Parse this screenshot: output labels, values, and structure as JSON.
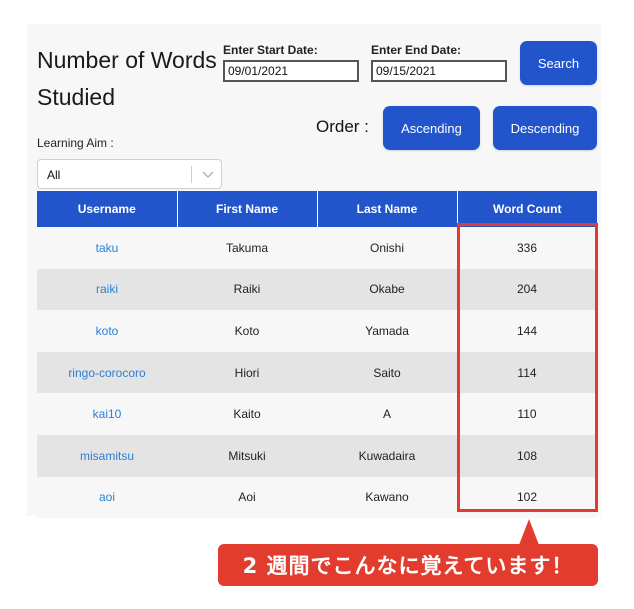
{
  "page": {
    "title": "Number of Words Studied"
  },
  "filters": {
    "start_date_label": "Enter Start Date:",
    "start_date_value": "09/01/2021",
    "end_date_label": "Enter End Date:",
    "end_date_value": "09/15/2021",
    "search_label": "Search",
    "order_label": "Order :",
    "ascending_label": "Ascending",
    "descending_label": "Descending",
    "learning_aim_label": "Learning Aim :",
    "learning_aim_value": "All"
  },
  "table": {
    "headers": [
      "Username",
      "First Name",
      "Last Name",
      "Word Count"
    ],
    "rows": [
      [
        "taku",
        "Takuma",
        "Onishi",
        "336"
      ],
      [
        "raiki",
        "Raiki",
        "Okabe",
        "204"
      ],
      [
        "koto",
        "Koto",
        "Yamada",
        "144"
      ],
      [
        "ringo-corocoro",
        "Hiori",
        "Saito",
        "114"
      ],
      [
        "kai10",
        "Kaito",
        "A",
        "110"
      ],
      [
        "misamitsu",
        "Mitsuki",
        "Kuwadaira",
        "108"
      ],
      [
        "aoi",
        "Aoi",
        "Kawano",
        "102"
      ]
    ]
  },
  "callout": {
    "text": "2 週間でこんなに覚えています！"
  },
  "colors": {
    "accent": "#2255cc",
    "link": "#2a7fd4",
    "highlight": "#e23c2f"
  }
}
